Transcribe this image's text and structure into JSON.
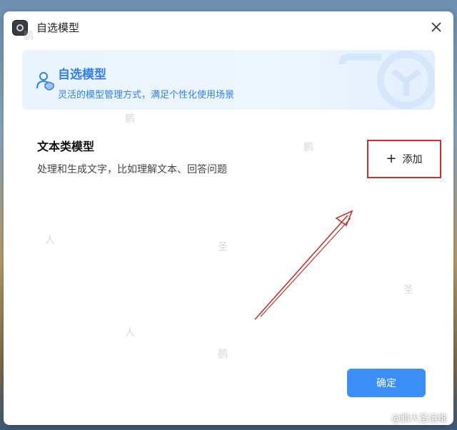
{
  "window": {
    "title": "自选模型"
  },
  "banner": {
    "title": "自选模型",
    "subtitle": "灵活的模型管理方式，满足个性化使用场景"
  },
  "section": {
    "title": "文本类模型",
    "description": "处理和生成文字，比如理解文本、回答问题",
    "add_label": "添加"
  },
  "footer": {
    "confirm_label": "确定",
    "watermark": "@鹏大圣运维"
  },
  "colors": {
    "accent": "#3a8ef6",
    "banner_text": "#2e7ff0",
    "highlight_box": "#c9302c"
  }
}
